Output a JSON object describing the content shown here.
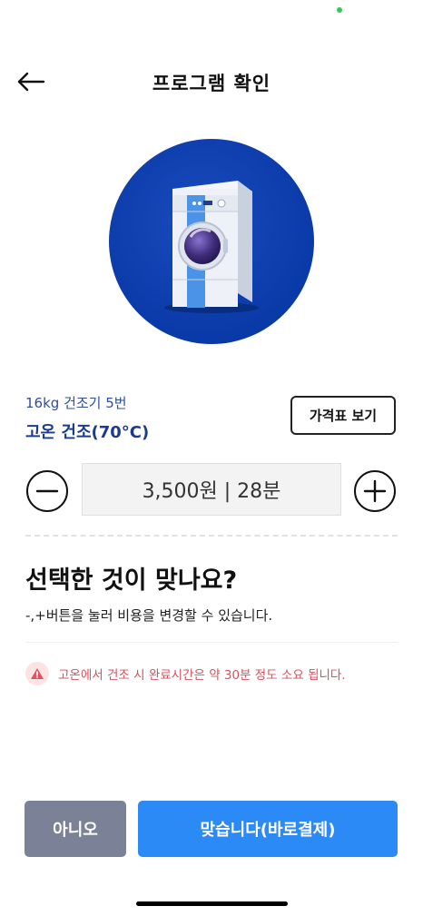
{
  "header": {
    "title": "프로그램 확인",
    "back_icon": "arrow-left-icon"
  },
  "hero": {
    "image": "dryer-machine-illustration",
    "circle_color": "#0a3aa8"
  },
  "machine": {
    "name": "16kg 건조기 5번",
    "program": "고온 건조(70°C)"
  },
  "price_table_button": {
    "label": "가격표 보기"
  },
  "stepper": {
    "minus_icon": "minus-circle-icon",
    "plus_icon": "plus-circle-icon",
    "value": "3,500원 | 28분"
  },
  "confirm": {
    "question": "선택한 것이 맞나요?",
    "helper": "-,+버튼을 눌러 비용을 변경할 수 있습니다."
  },
  "warning": {
    "icon": "warning-triangle-icon",
    "text": "고온에서 건조 시 완료시간은 약 30분 정도 소요 됩니다.",
    "color": "#d8505c"
  },
  "actions": {
    "no_label": "아니오",
    "yes_label": "맞습니다(바로결제)",
    "no_color": "#7b8197",
    "yes_color": "#2b8af5"
  }
}
